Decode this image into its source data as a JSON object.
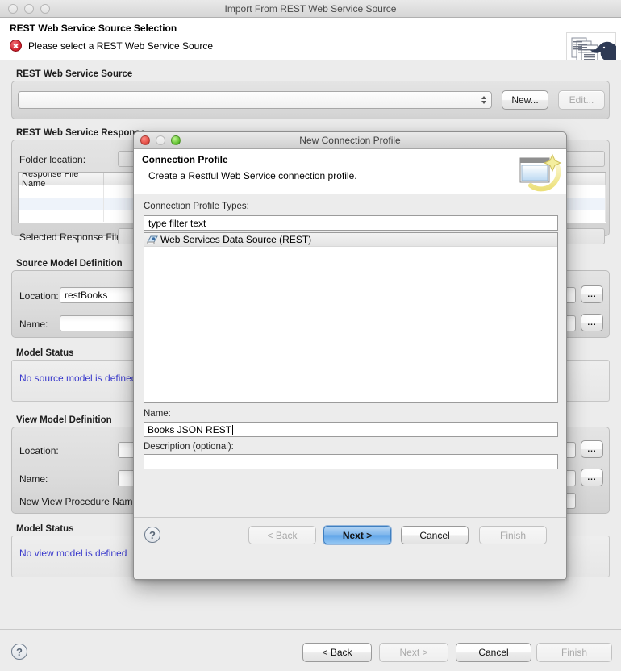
{
  "main_window": {
    "title": "Import From REST Web Service Source",
    "traffic_lights": [
      "close-inactive",
      "minimize-inactive",
      "zoom-inactive"
    ],
    "header": {
      "title": "REST Web Service Source Selection",
      "status_icon": "error-icon",
      "message": "Please select a REST Web Service Source",
      "banner_icon": "teiid-import-banner-icon"
    },
    "groups": {
      "rest_source": {
        "label": "REST Web Service Source",
        "combo_value": "",
        "combo_icon": "updown-arrows-icon",
        "new_button": "New...",
        "edit_button": "Edit...",
        "edit_enabled": false
      },
      "rest_response": {
        "label": "REST Web Service Response",
        "folder_location_label": "Folder location:",
        "folder_location_value": "",
        "table_columns": [
          "Response File Name",
          ""
        ],
        "table_rows": [
          [
            "",
            ""
          ],
          [
            "",
            ""
          ],
          [
            "",
            ""
          ]
        ],
        "selected_response_label": "Selected Response File:",
        "selected_response_value": ""
      },
      "source_model": {
        "label": "Source Model Definition",
        "location_label": "Location:",
        "location_value": "restBooks",
        "location_browse": "...",
        "name_label": "Name:",
        "name_value": "",
        "name_browse": "..."
      },
      "source_status": {
        "label": "Model Status",
        "text": "No source model is defined"
      },
      "view_model": {
        "label": "View Model Definition",
        "location_label": "Location:",
        "location_value": "",
        "location_browse": "...",
        "name_label": "Name:",
        "name_value": "",
        "name_browse": "...",
        "procedure_label": "New View Procedure Name:",
        "procedure_value": ""
      },
      "view_status": {
        "label": "Model Status",
        "text": "No view model is defined"
      }
    },
    "footer": {
      "help_icon": "help-question-icon",
      "back": "< Back",
      "back_enabled": true,
      "next": "Next >",
      "next_enabled": false,
      "cancel": "Cancel",
      "cancel_enabled": true,
      "finish": "Finish",
      "finish_enabled": false
    }
  },
  "modal": {
    "title": "New Connection Profile",
    "traffic_lights": [
      "close-active",
      "minimize-inactive",
      "zoom-active"
    ],
    "header": {
      "title": "Connection Profile",
      "subtitle": "Create a Restful Web Service connection profile.",
      "icon": "new-profile-wizard-icon"
    },
    "types_label": "Connection Profile Types:",
    "filter_placeholder": "type filter text",
    "filter_value": "type filter text",
    "types": [
      {
        "label": "Web Services Data Source (REST)",
        "icon": "web-service-icon",
        "selected": true
      }
    ],
    "name_label": "Name:",
    "name_value": "Books JSON REST",
    "description_label": "Description (optional):",
    "description_value": "",
    "footer": {
      "help_icon": "help-question-icon",
      "back": "< Back",
      "back_enabled": false,
      "next": "Next >",
      "next_enabled": true,
      "next_default": true,
      "cancel": "Cancel",
      "cancel_enabled": true,
      "finish": "Finish",
      "finish_enabled": false
    }
  },
  "colors": {
    "window_bg": "#ececec",
    "status_text": "#3a3acc",
    "default_button": "#5ea4e8",
    "error_red": "#d0202c"
  }
}
